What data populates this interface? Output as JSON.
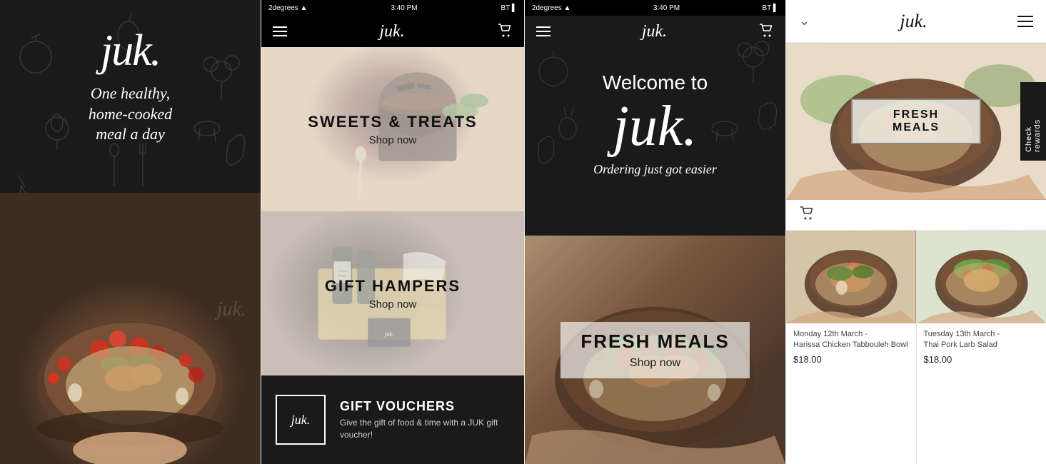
{
  "panel1": {
    "logo": "juk.",
    "tagline_line1": "One healthy,",
    "tagline_line2": "home-cooked",
    "tagline_line3": "meal a day",
    "watermark": "juk."
  },
  "panel2": {
    "status_bar": {
      "carrier": "2degrees",
      "signal": "▲▲▲",
      "wifi": "wifi",
      "time": "3:40 PM",
      "bluetooth": "BT",
      "battery": "█▌"
    },
    "nav": {
      "menu_label": "menu",
      "logo": "juk.",
      "cart_label": "cart"
    },
    "sweets": {
      "title": "SWEETS & TREATS",
      "cta": "Shop now"
    },
    "hampers": {
      "title": "GIFT HAMPERS",
      "cta": "Shop now"
    },
    "vouchers": {
      "logo": "juk.",
      "title": "GIFT VOUCHERS",
      "description": "Give the gift of food & time with a JUK gift voucher!"
    }
  },
  "panel3": {
    "status_bar": {
      "carrier": "2degrees",
      "signal": "▲▲▲",
      "wifi": "wifi",
      "time": "3:40 PM",
      "bluetooth": "BT",
      "battery": "█▌"
    },
    "nav": {
      "menu_label": "menu",
      "logo": "juk.",
      "cart_label": "cart"
    },
    "welcome": "Welcome to",
    "logo": "juk.",
    "subtitle": "Ordering just got easier",
    "fresh_meals": {
      "title": "FRESH MEALS",
      "cta": "Shop now"
    }
  },
  "panel4": {
    "header": {
      "chevron": "chevron",
      "logo": "juk.",
      "menu_label": "menu"
    },
    "fresh_meals_banner": "FRESH MEALS",
    "check_rewards": "Check rewards",
    "cart_label": "cart",
    "products": [
      {
        "date": "Monday 12th March -",
        "name": "Harissa Chicken Tabbouleh Bowl",
        "price": "$18.00"
      },
      {
        "date": "Tuesday 13th March -",
        "name": "Thai Pork Larb Salad",
        "price": "$18.00"
      }
    ]
  }
}
